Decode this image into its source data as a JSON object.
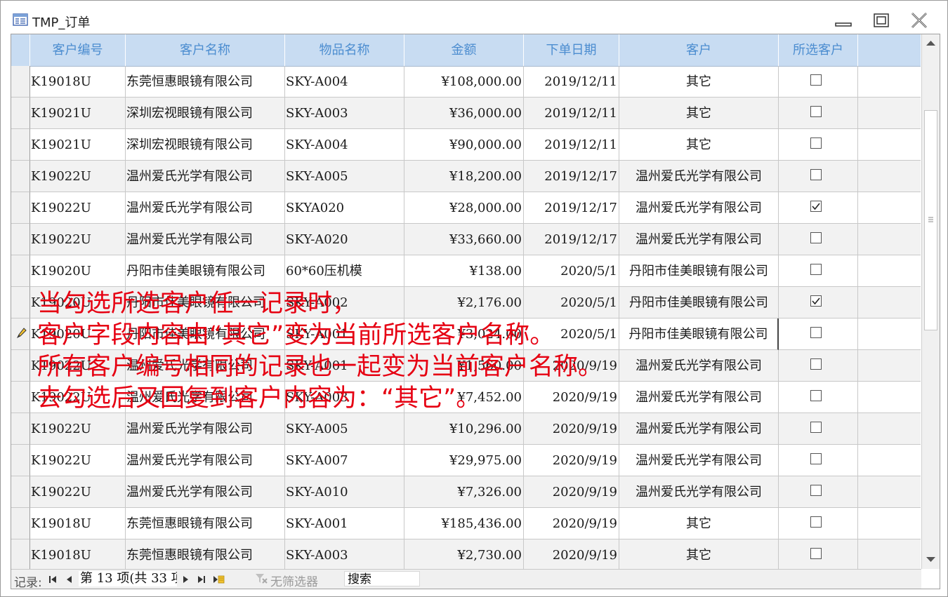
{
  "window": {
    "title": "TMP_订单",
    "controls": [
      "minimize",
      "maximize",
      "close"
    ]
  },
  "grid": {
    "columns": [
      "客户编号",
      "客户名称",
      "物品名称",
      "金额",
      "下单日期",
      "客户",
      "所选客户"
    ],
    "rows": [
      {
        "id": "K19018U",
        "name": "东莞恒惠眼镜有限公司",
        "item": "SKY-A004",
        "amount": "¥108,000.00",
        "date": "2019/12/11",
        "customer": "其它",
        "checked": false,
        "current": false
      },
      {
        "id": "K19021U",
        "name": "深圳宏视眼镜有限公司",
        "item": "SKY-A003",
        "amount": "¥36,000.00",
        "date": "2019/12/11",
        "customer": "其它",
        "checked": false,
        "current": false
      },
      {
        "id": "K19021U",
        "name": "深圳宏视眼镜有限公司",
        "item": "SKY-A004",
        "amount": "¥90,000.00",
        "date": "2019/12/11",
        "customer": "其它",
        "checked": false,
        "current": false
      },
      {
        "id": "K19022U",
        "name": "温州爱氏光学有限公司",
        "item": "SKY-A005",
        "amount": "¥18,200.00",
        "date": "2019/12/17",
        "customer": "温州爱氏光学有限公司",
        "checked": false,
        "current": false
      },
      {
        "id": "K19022U",
        "name": "温州爱氏光学有限公司",
        "item": "SKYA020",
        "amount": "¥28,000.00",
        "date": "2019/12/17",
        "customer": "温州爱氏光学有限公司",
        "checked": true,
        "current": false
      },
      {
        "id": "K19022U",
        "name": "温州爱氏光学有限公司",
        "item": "SKY-A020",
        "amount": "¥33,660.00",
        "date": "2019/12/17",
        "customer": "温州爱氏光学有限公司",
        "checked": false,
        "current": false
      },
      {
        "id": "K19020U",
        "name": "丹阳市佳美眼镜有限公司",
        "item": "60*60压机模",
        "amount": "¥138.00",
        "date": "2020/5/1",
        "customer": "丹阳市佳美眼镜有限公司",
        "checked": false,
        "current": false
      },
      {
        "id": "K19020U",
        "name": "丹阳市佳美眼镜有限公司",
        "item": "SKY-A002",
        "amount": "¥2,176.00",
        "date": "2020/5/1",
        "customer": "丹阳市佳美眼镜有限公司",
        "checked": true,
        "current": false
      },
      {
        "id": "K19020U",
        "name": "丹阳市佳美眼镜有限公司",
        "item": "SKY-A001",
        "amount": "¥3,024.00",
        "date": "2020/5/1",
        "customer": "丹阳市佳美眼镜有限公司",
        "checked": false,
        "current": true
      },
      {
        "id": "K19022U",
        "name": "温州爱氏光学有限公司",
        "item": "SKY-A001",
        "amount": "¥1,560.00",
        "date": "2020/9/19",
        "customer": "温州爱氏光学有限公司",
        "checked": false,
        "current": false
      },
      {
        "id": "K19022U",
        "name": "温州爱氏光学有限公司",
        "item": "SKY-A003",
        "amount": "¥7,452.00",
        "date": "2020/9/19",
        "customer": "温州爱氏光学有限公司",
        "checked": false,
        "current": false
      },
      {
        "id": "K19022U",
        "name": "温州爱氏光学有限公司",
        "item": "SKY-A005",
        "amount": "¥10,296.00",
        "date": "2020/9/19",
        "customer": "温州爱氏光学有限公司",
        "checked": false,
        "current": false
      },
      {
        "id": "K19022U",
        "name": "温州爱氏光学有限公司",
        "item": "SKY-A007",
        "amount": "¥29,975.00",
        "date": "2020/9/19",
        "customer": "温州爱氏光学有限公司",
        "checked": false,
        "current": false
      },
      {
        "id": "K19022U",
        "name": "温州爱氏光学有限公司",
        "item": "SKY-A010",
        "amount": "¥7,326.00",
        "date": "2020/9/19",
        "customer": "温州爱氏光学有限公司",
        "checked": false,
        "current": false
      },
      {
        "id": "K19018U",
        "name": "东莞恒惠眼镜有限公司",
        "item": "SKY-A001",
        "amount": "¥185,436.00",
        "date": "2020/9/19",
        "customer": "其它",
        "checked": false,
        "current": false
      },
      {
        "id": "K19018U",
        "name": "东莞恒惠眼镜有限公司",
        "item": "SKY-A003",
        "amount": "¥2,730.00",
        "date": "2020/9/19",
        "customer": "其它",
        "checked": false,
        "current": false
      }
    ]
  },
  "navigation": {
    "label": "记录:",
    "record_text": "第 13 项(共 33 项",
    "filter_label": "无筛选器",
    "search_label": "搜索"
  },
  "annotation": {
    "lines": [
      "当勾选所选客户任一记录时，",
      "客户字段内容由“其它”变为当前所选客户名称。",
      "所有客户编号相同的记录也一起变为当前客户名称。",
      "去勾选后又回复到客户内容为：“其它”。"
    ],
    "color": "#e60012"
  },
  "colors": {
    "header_bg": "#c8dcf2",
    "header_text": "#4c8dd0",
    "alt_row": "#f2f2f2"
  }
}
